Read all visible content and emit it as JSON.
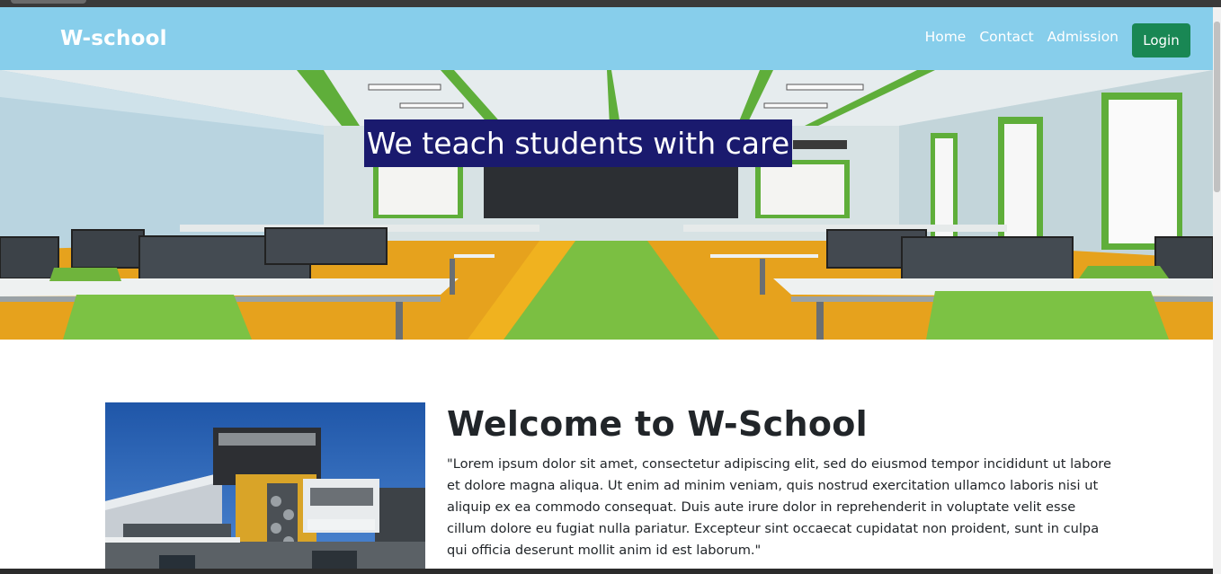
{
  "navbar": {
    "brand": "W-school",
    "links": [
      "Home",
      "Contact",
      "Admission"
    ],
    "login_label": "Login",
    "background": "#87ceeb",
    "login_color": "#198754"
  },
  "hero": {
    "caption": "We teach students with care",
    "caption_bg": "#1a1a6e"
  },
  "welcome": {
    "title": "Welcome to W-School",
    "text": "\"Lorem ipsum dolor sit amet, consectetur adipiscing elit, sed do eiusmod tempor incididunt ut labore et dolore magna aliqua. Ut enim ad minim veniam, quis nostrud exercitation ullamco laboris nisi ut aliquip ex ea commodo consequat. Duis aute irure dolor in reprehenderit in voluptate velit esse cillum dolore eu fugiat nulla pariatur. Excepteur sint occaecat cupidatat non proident, sunt in culpa qui officia deserunt mollit anim id est laborum.\""
  },
  "icons": [
    "classroom-image",
    "school-building-image"
  ]
}
